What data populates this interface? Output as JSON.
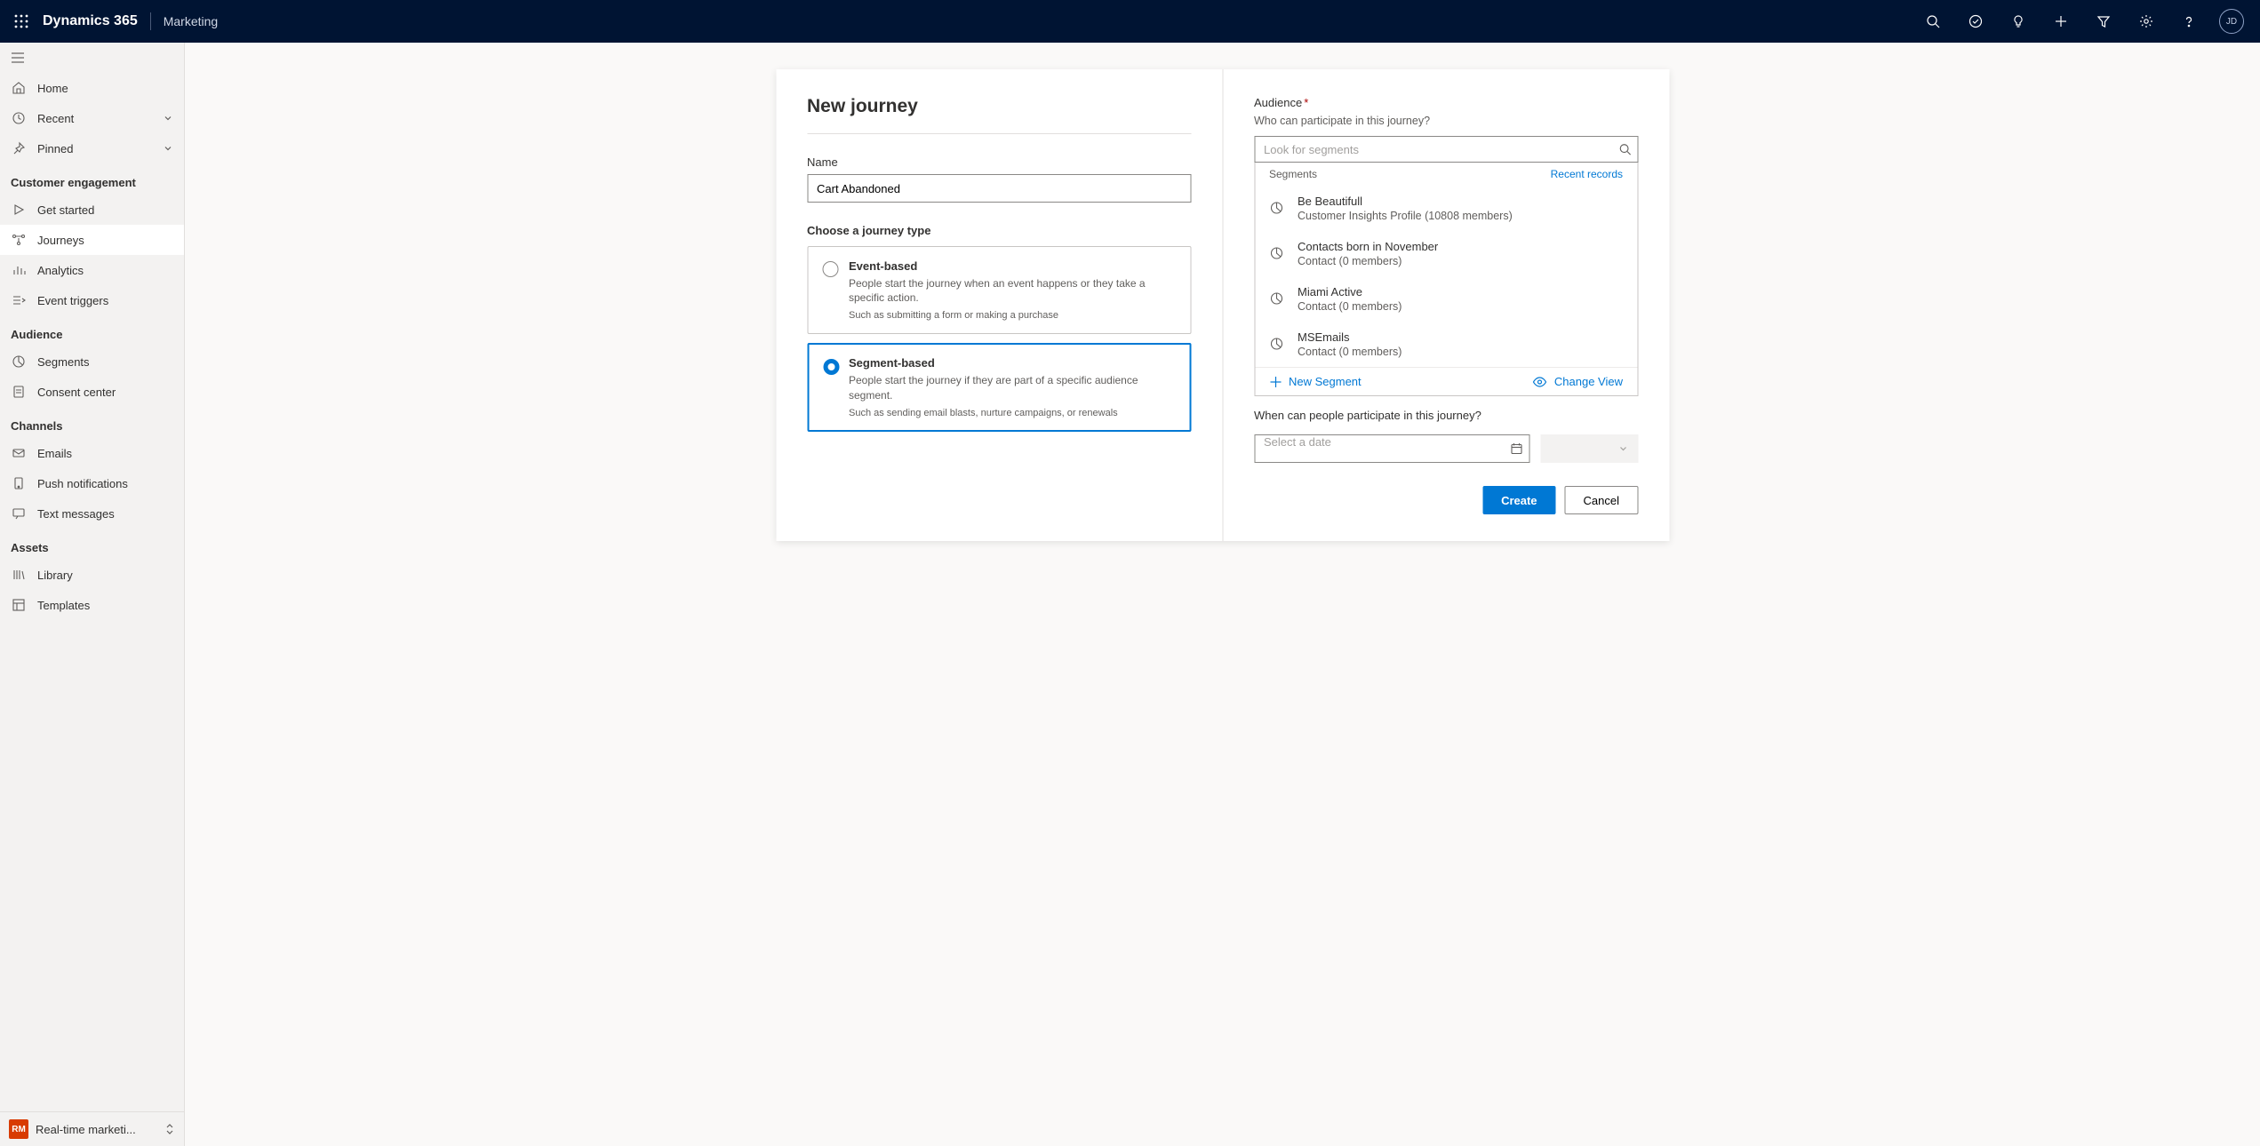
{
  "topnav": {
    "brand": "Dynamics 365",
    "module": "Marketing",
    "avatar_initials": "JD"
  },
  "sidebar": {
    "home": "Home",
    "recent": "Recent",
    "pinned": "Pinned",
    "sections": {
      "customer_engagement": {
        "header": "Customer engagement",
        "items": [
          "Get started",
          "Journeys",
          "Analytics",
          "Event triggers"
        ]
      },
      "audience": {
        "header": "Audience",
        "items": [
          "Segments",
          "Consent center"
        ]
      },
      "channels": {
        "header": "Channels",
        "items": [
          "Emails",
          "Push notifications",
          "Text messages"
        ]
      },
      "assets": {
        "header": "Assets",
        "items": [
          "Library",
          "Templates"
        ]
      }
    },
    "area_badge": "RM",
    "area_name": "Real-time marketi..."
  },
  "dialog": {
    "title": "New journey",
    "name_label": "Name",
    "name_value": "Cart Abandoned",
    "journey_type_label": "Choose a journey type",
    "types": {
      "event": {
        "title": "Event-based",
        "desc": "People start the journey when an event happens or they take a specific action.",
        "example": "Such as submitting a form or making a purchase"
      },
      "segment": {
        "title": "Segment-based",
        "desc": "People start the journey if they are part of a specific audience segment.",
        "example": "Such as sending email blasts, nurture campaigns, or renewals"
      }
    },
    "audience_label": "Audience",
    "audience_sub": "Who can participate in this journey?",
    "segment_search_placeholder": "Look for segments",
    "seg_header_left": "Segments",
    "seg_header_right": "Recent records",
    "segments": [
      {
        "name": "Be Beautifull",
        "meta": "Customer Insights Profile (10808 members)"
      },
      {
        "name": "Contacts born in November",
        "meta": "Contact (0 members)"
      },
      {
        "name": "Miami Active",
        "meta": "Contact (0 members)"
      },
      {
        "name": "MSEmails",
        "meta": "Contact (0 members)"
      }
    ],
    "new_segment": "New Segment",
    "change_view": "Change View",
    "when_label": "When can people participate in this journey?",
    "date_placeholder": "Select a date",
    "create": "Create",
    "cancel": "Cancel"
  }
}
